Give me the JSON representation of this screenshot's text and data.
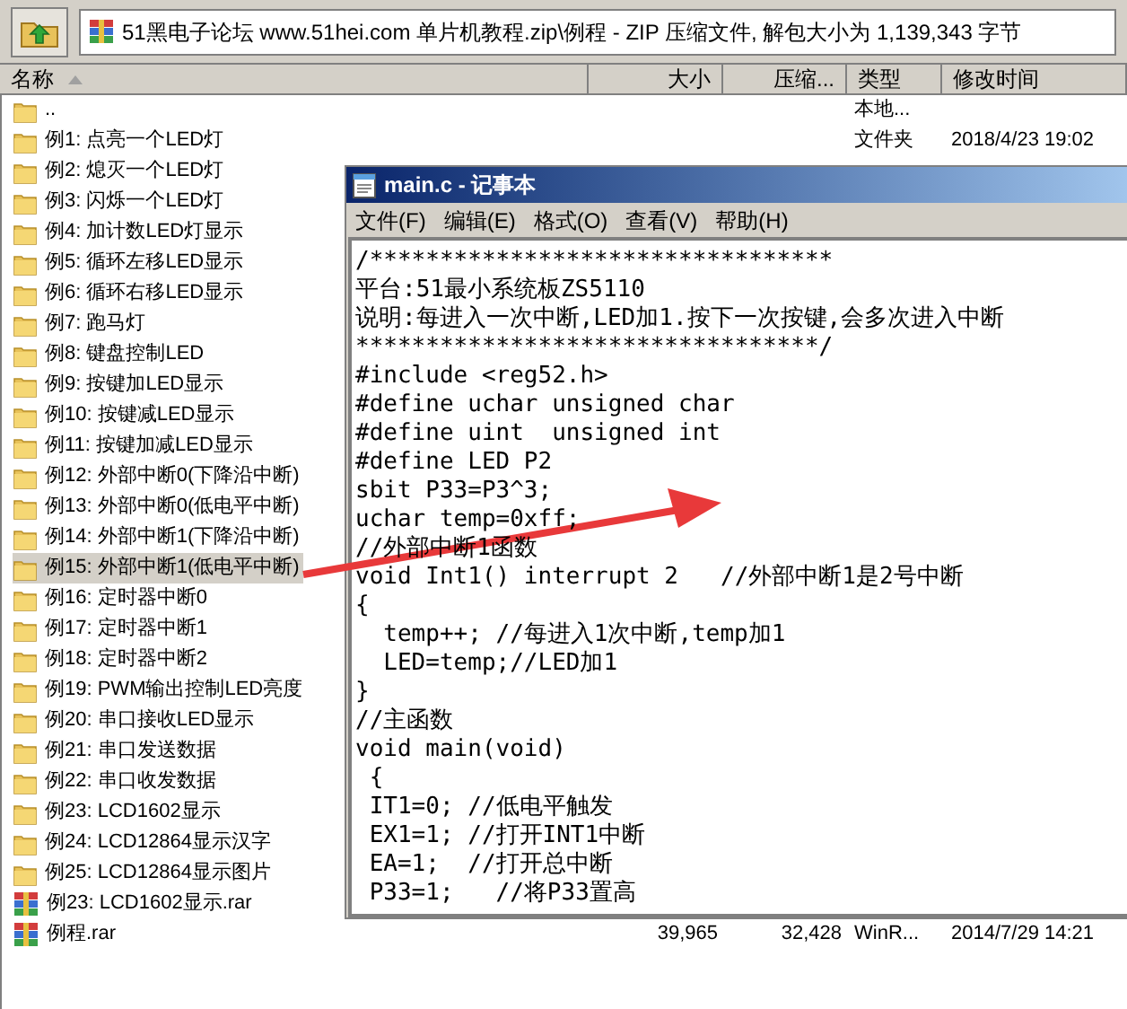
{
  "toolbar": {
    "address": "51黑电子论坛 www.51hei.com 单片机教程.zip\\例程 - ZIP 压缩文件, 解包大小为 1,139,343 字节"
  },
  "file_list": {
    "columns": [
      {
        "label": "名称",
        "sorted": true
      },
      {
        "label": "大小",
        "sorted": false
      },
      {
        "label": "压缩...",
        "sorted": false
      },
      {
        "label": "类型",
        "sorted": false
      },
      {
        "label": "修改时间",
        "sorted": false
      }
    ],
    "rows": [
      {
        "kind": "folder",
        "name": "..",
        "type": "本地...",
        "selected": false
      },
      {
        "kind": "folder",
        "name": "例1: 点亮一个LED灯",
        "type": "文件夹",
        "modified": "2018/4/23 19:02",
        "selected": false
      },
      {
        "kind": "folder",
        "name": "例2: 熄灭一个LED灯",
        "selected": false
      },
      {
        "kind": "folder",
        "name": "例3: 闪烁一个LED灯",
        "selected": false
      },
      {
        "kind": "folder",
        "name": "例4: 加计数LED灯显示",
        "selected": false
      },
      {
        "kind": "folder",
        "name": "例5: 循环左移LED显示",
        "selected": false
      },
      {
        "kind": "folder",
        "name": "例6: 循环右移LED显示",
        "selected": false
      },
      {
        "kind": "folder",
        "name": "例7: 跑马灯",
        "selected": false
      },
      {
        "kind": "folder",
        "name": "例8: 键盘控制LED",
        "selected": false
      },
      {
        "kind": "folder",
        "name": "例9: 按键加LED显示",
        "selected": false
      },
      {
        "kind": "folder",
        "name": "例10: 按键减LED显示",
        "selected": false
      },
      {
        "kind": "folder",
        "name": "例11: 按键加减LED显示",
        "selected": false
      },
      {
        "kind": "folder",
        "name": "例12: 外部中断0(下降沿中断)",
        "selected": false
      },
      {
        "kind": "folder",
        "name": "例13: 外部中断0(低电平中断)",
        "selected": false
      },
      {
        "kind": "folder",
        "name": "例14: 外部中断1(下降沿中断)",
        "selected": false
      },
      {
        "kind": "folder",
        "name": "例15: 外部中断1(低电平中断)",
        "selected": true
      },
      {
        "kind": "folder",
        "name": "例16: 定时器中断0",
        "selected": false
      },
      {
        "kind": "folder",
        "name": "例17: 定时器中断1",
        "selected": false
      },
      {
        "kind": "folder",
        "name": "例18: 定时器中断2",
        "selected": false
      },
      {
        "kind": "folder",
        "name": "例19: PWM输出控制LED亮度",
        "selected": false
      },
      {
        "kind": "folder",
        "name": "例20: 串口接收LED显示",
        "selected": false
      },
      {
        "kind": "folder",
        "name": "例21: 串口发送数据",
        "selected": false
      },
      {
        "kind": "folder",
        "name": "例22: 串口收发数据",
        "selected": false
      },
      {
        "kind": "folder",
        "name": "例23: LCD1602显示",
        "selected": false
      },
      {
        "kind": "folder",
        "name": "例24: LCD12864显示汉字",
        "selected": false
      },
      {
        "kind": "folder",
        "name": "例25: LCD12864显示图片",
        "selected": false
      },
      {
        "kind": "archive",
        "name": "例23: LCD1602显示.rar",
        "selected": false
      },
      {
        "kind": "archive",
        "name": "例程.rar",
        "size": "39,965",
        "packed": "32,428",
        "type": "WinR...",
        "modified": "2014/7/29 14:21",
        "selected": false
      }
    ]
  },
  "notepad": {
    "title": "main.c - 记事本",
    "menu": [
      "文件(F)",
      "编辑(E)",
      "格式(O)",
      "查看(V)",
      "帮助(H)"
    ],
    "lines": [
      "/*********************************",
      "平台:51最小系统板ZS5110",
      "说明:每进入一次中断,LED加1.按下一次按键,会多次进入中断",
      "*********************************/",
      "#include <reg52.h>",
      "#define uchar unsigned char",
      "#define uint  unsigned int",
      "#define LED P2",
      "sbit P33=P3^3;",
      "uchar temp=0xff;",
      "//外部中断1函数",
      "void Int1() interrupt 2   //外部中断1是2号中断",
      "{",
      "  temp++; //每进入1次中断,temp加1",
      "  LED=temp;//LED加1",
      "}",
      "//主函数",
      "void main(void)",
      " {",
      " IT1=0; //低电平触发",
      " EX1=1; //打开INT1中断",
      " EA=1;  //打开总中断",
      " P33=1;   //将P33置高"
    ]
  }
}
